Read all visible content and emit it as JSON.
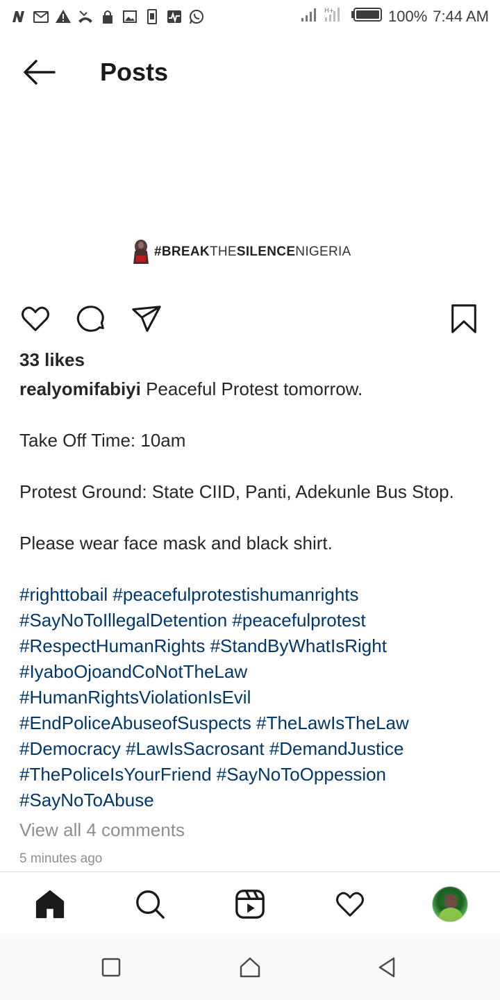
{
  "status_bar": {
    "battery": "100%",
    "time": "7:44 AM",
    "left_icons": [
      "nfc-n-icon",
      "gmail-icon",
      "warning-icon",
      "missed-call-icon",
      "lock-icon",
      "image-icon",
      "sim-icon",
      "activity-icon",
      "whatsapp-icon"
    ],
    "right_icons": [
      "signal-icon",
      "signal-ht-icon",
      "battery-icon"
    ]
  },
  "header": {
    "title": "Posts",
    "back_icon": "arrow-left-icon"
  },
  "post": {
    "image_brand": {
      "part1": "#BREAK",
      "part2": "THE",
      "part3": "SILENCE",
      "part4": "NIGERIA"
    },
    "likes": "33 likes",
    "username": "realyomifabiyi",
    "caption_first": " Peaceful Protest tomorrow.",
    "caption_lines": [
      "",
      "Take Off Time: 10am",
      "",
      "Protest Ground: State CIID, Panti, Adekunle Bus Stop.",
      "",
      "Please wear face mask and black shirt.",
      ""
    ],
    "hashtags": [
      "#righttobail #peacefulprotestishumanrights",
      "#SayNoToIllegalDetention #peacefulprotest",
      "#RespectHumanRights #StandByWhatIsRight",
      "#IyaboOjoandCoNotTheLaw",
      "#HumanRightsViolationIsEvil",
      "#EndPoliceAbuseofSuspects #TheLawIsTheLaw",
      "#Democracy #LawIsSacrosant #DemandJustice",
      "#ThePoliceIsYourFriend #SayNoToOppession",
      "#SayNoToAbuse"
    ],
    "comments_link": "View all 4 comments",
    "timestamp": "5 minutes ago"
  },
  "actions": [
    "heart-icon",
    "comment-icon",
    "share-icon",
    "bookmark-icon"
  ],
  "bottom_nav": [
    "home-icon",
    "search-icon",
    "reels-icon",
    "activity-heart-icon",
    "profile-avatar"
  ],
  "system_nav": [
    "recents-icon",
    "home-system-icon",
    "back-system-icon"
  ],
  "colors": {
    "hashtag": "#00376b",
    "muted": "#8e8e8e",
    "text": "#262626"
  }
}
